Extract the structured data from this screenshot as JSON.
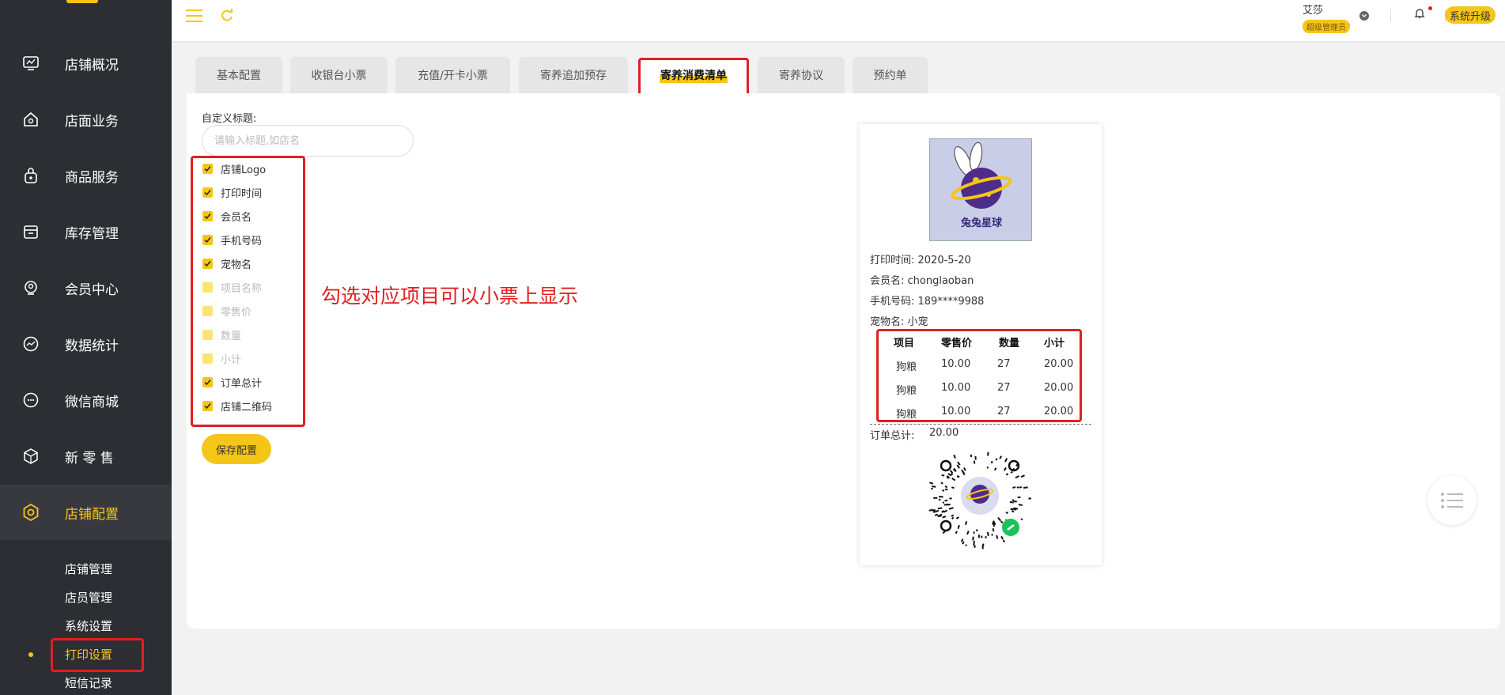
{
  "sidebar": {
    "items": [
      {
        "label": "店铺概况",
        "icon": "monitor-icon"
      },
      {
        "label": "店面业务",
        "icon": "house-icon"
      },
      {
        "label": "商品服务",
        "icon": "bag-icon"
      },
      {
        "label": "库存管理",
        "icon": "box-icon"
      },
      {
        "label": "会员中心",
        "icon": "member-icon"
      },
      {
        "label": "数据统计",
        "icon": "chart-icon"
      },
      {
        "label": "微信商城",
        "icon": "chat-icon"
      },
      {
        "label": "新 零 售",
        "icon": "cube-icon"
      },
      {
        "label": "店铺配置",
        "icon": "settings-icon"
      }
    ],
    "sub_items": [
      "店铺管理",
      "店员管理",
      "系统设置",
      "打印设置",
      "短信记录"
    ]
  },
  "topbar": {
    "user_name": "艾莎",
    "user_role": "超级管理员",
    "upgrade_label": "系统升级"
  },
  "tabs": [
    "基本配置",
    "收银台小票",
    "充值/开卡小票",
    "寄养追加预存",
    "寄养消费清单",
    "寄养协议",
    "预约单"
  ],
  "form": {
    "title_label": "自定义标题:",
    "title_placeholder": "请输入标题,如店名",
    "options": [
      {
        "label": "店铺Logo",
        "checked": true
      },
      {
        "label": "打印时间",
        "checked": true
      },
      {
        "label": "会员名",
        "checked": true
      },
      {
        "label": "手机号码",
        "checked": true
      },
      {
        "label": "宠物名",
        "checked": true
      },
      {
        "label": "项目名称",
        "checked": false
      },
      {
        "label": "零售价",
        "checked": false
      },
      {
        "label": "数量",
        "checked": false
      },
      {
        "label": "小计",
        "checked": false
      },
      {
        "label": "订单总计",
        "checked": true
      },
      {
        "label": "店铺二维码",
        "checked": true
      }
    ],
    "hint": "勾选对应项目可以小票上显示",
    "save_label": "保存配置"
  },
  "receipt": {
    "logo_text": "兔兔星球",
    "print_time": "打印时间: 2020-5-20",
    "member": "会员名: chonglaoban",
    "phone": "手机号码: 189****9988",
    "pet": "宠物名: 小宠",
    "table_headers": [
      "项目",
      "零售价",
      "数量",
      "小计"
    ],
    "rows": [
      [
        "狗粮",
        "10.00",
        "27",
        "20.00"
      ],
      [
        "狗粮",
        "10.00",
        "27",
        "20.00"
      ],
      [
        "狗粮",
        "10.00",
        "27",
        "20.00"
      ]
    ],
    "total_label": "订单总计:",
    "total_value": "20.00"
  },
  "colors": {
    "accent": "#f5c518",
    "sidebar_bg": "#2d2e33",
    "annotation_red": "#e02020"
  }
}
